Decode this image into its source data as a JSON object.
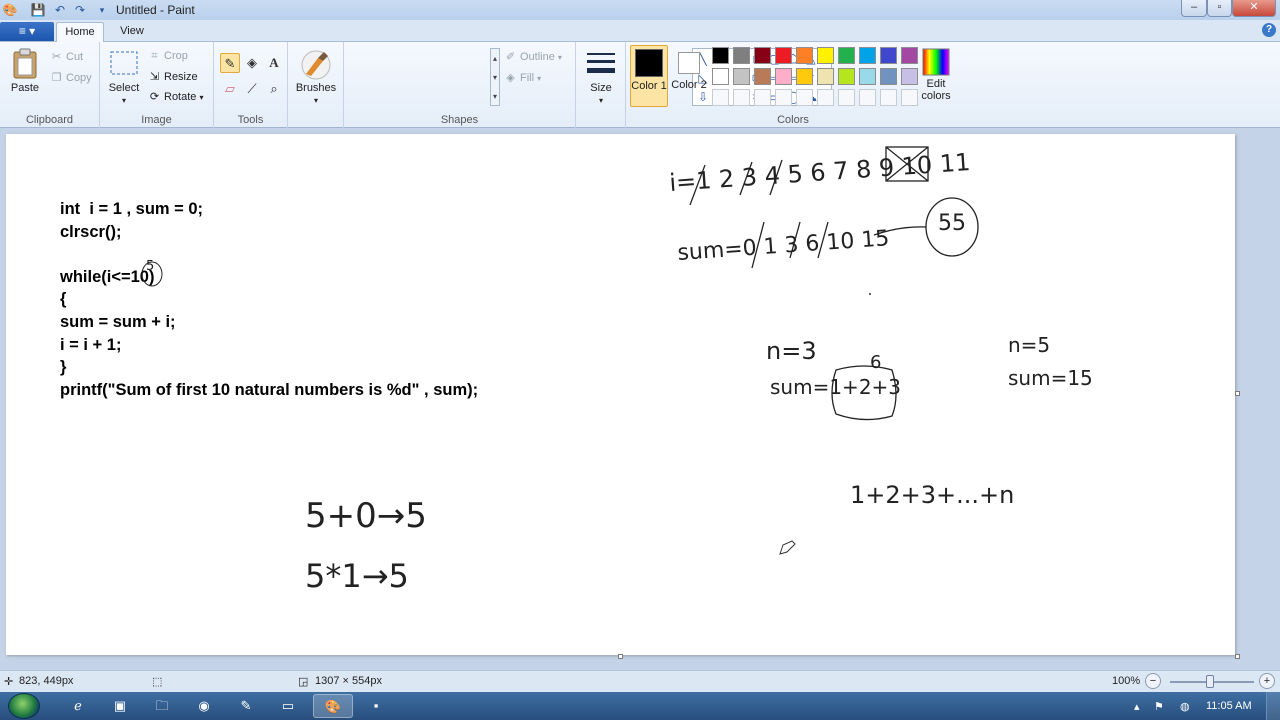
{
  "window": {
    "title": "Untitled - Paint"
  },
  "quick_access": {
    "app_icon": "paint-app-icon",
    "save_icon": "save-icon",
    "undo_icon": "undo-icon",
    "redo_icon": "redo-icon",
    "customize_icon": "dropdown-arrow-icon"
  },
  "window_controls": {
    "minimize": "–",
    "maximize": "▫",
    "close": "✕"
  },
  "tabs": {
    "file_menu": "≡ ▾",
    "home": "Home",
    "view": "View",
    "help": "?"
  },
  "ribbon": {
    "clipboard": {
      "paste": "Paste",
      "cut": "Cut",
      "copy": "Copy",
      "label": "Clipboard"
    },
    "image": {
      "select": "Select",
      "crop": "Crop",
      "resize": "Resize",
      "rotate": "Rotate",
      "label": "Image"
    },
    "tools": {
      "label": "Tools"
    },
    "brushes": {
      "label": "Brushes"
    },
    "shapes": {
      "outline": "Outline",
      "fill": "Fill",
      "label": "Shapes"
    },
    "size": {
      "label": "Size"
    },
    "colors": {
      "color1": "Color 1",
      "color2": "Color 2",
      "edit": "Edit colors",
      "label": "Colors",
      "color1_value": "#000000",
      "color2_value": "#ffffff",
      "palette_row1": [
        "#000000",
        "#7f7f7f",
        "#880015",
        "#ed1c24",
        "#ff7f27",
        "#fff200",
        "#22b14c",
        "#00a2e8",
        "#3f48cc",
        "#a349a4"
      ],
      "palette_row2": [
        "#ffffff",
        "#c3c3c3",
        "#b97a57",
        "#ffaec9",
        "#ffc90e",
        "#efe4b0",
        "#b5e61d",
        "#99d9ea",
        "#7092be",
        "#c8bfe7"
      ]
    }
  },
  "canvas": {
    "code_lines": [
      "int  i = 1 , sum = 0;",
      "clrscr();",
      "",
      "while(i<=10)",
      "{",
      "sum = sum + i;",
      "i = i + 1;",
      "}",
      "printf(\"Sum of first 10 natural numbers is %d\" , sum);"
    ],
    "handwriting": {
      "i_sequence": "i=1 2 3 4 5 6 7 8 9 10 11",
      "sum_sequence": "sum=0 1 3 6 10 15",
      "result_circle": "55",
      "n3": "n=3",
      "six": "6",
      "sum_expr": "sum=1+2+3",
      "n5": "n=5",
      "sum15": "sum=15",
      "general": "1+2+3+...+n",
      "add_identity": "5+0→5",
      "mul_identity": "5*1→5",
      "overwrite_5": "5"
    }
  },
  "status": {
    "cursor_pos": "823, 449px",
    "selection_size": "",
    "canvas_size": "1307 × 554px",
    "zoom": "100%"
  },
  "taskbar": {
    "time": "11:05 AM"
  }
}
